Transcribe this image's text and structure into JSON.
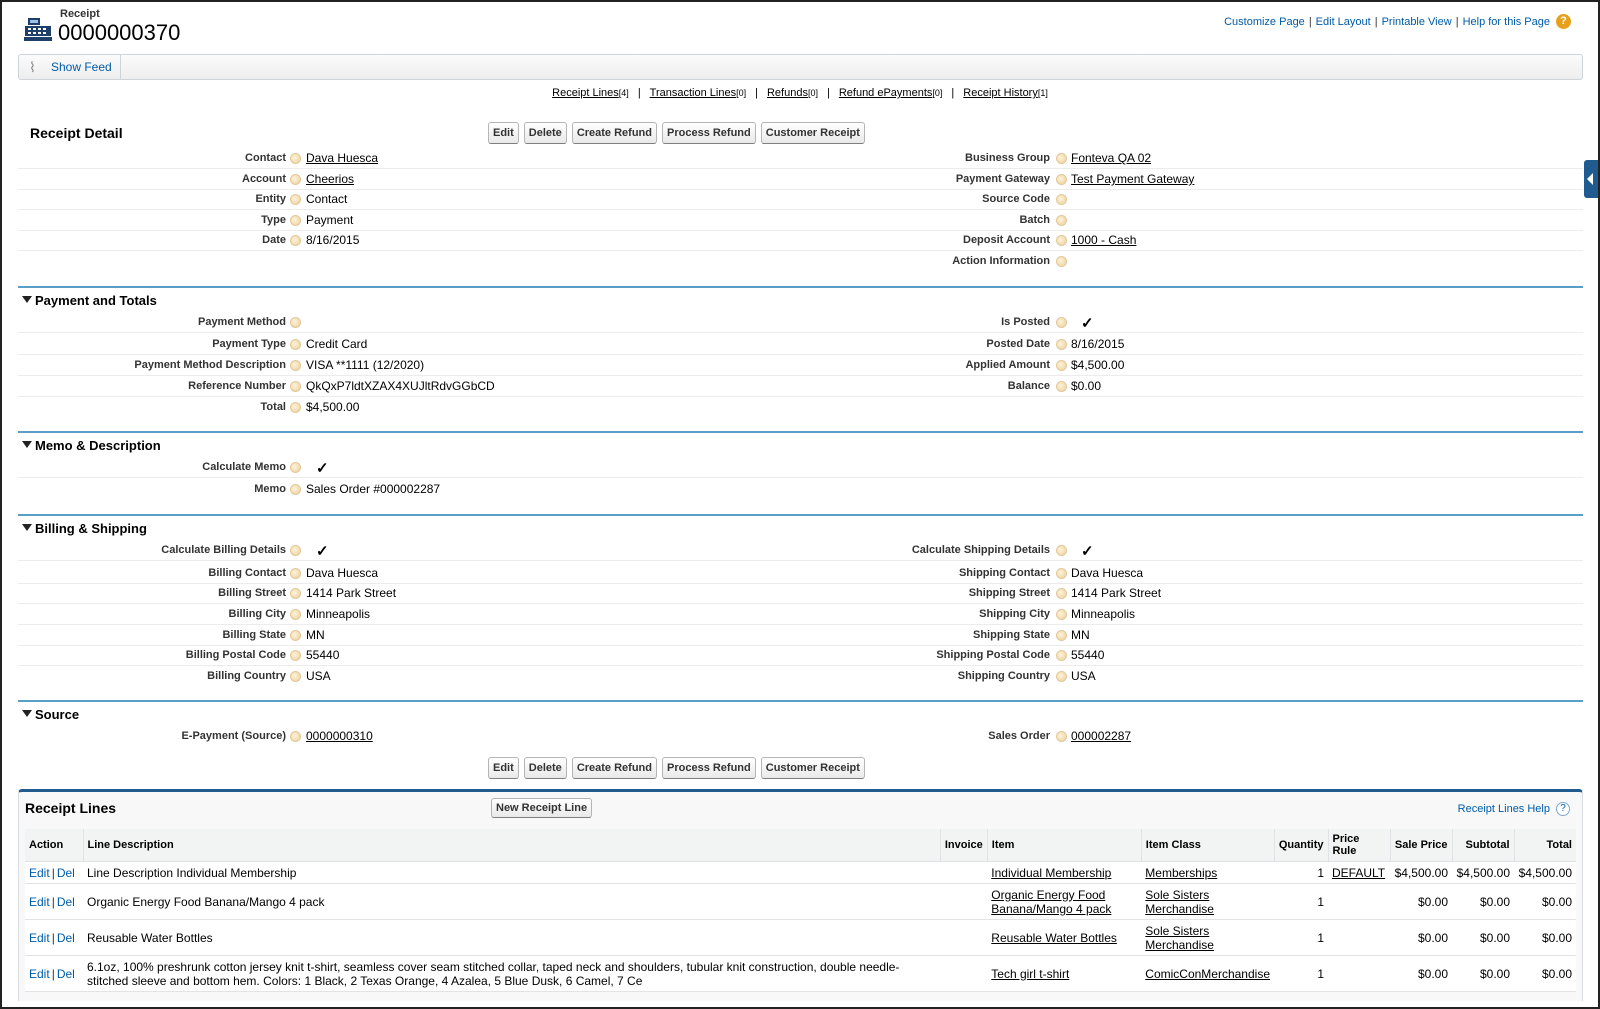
{
  "header": {
    "object_type": "Receipt",
    "record_name": "0000000370",
    "links": [
      "Customize Page",
      "Edit Layout",
      "Printable View",
      "Help for this Page"
    ],
    "help_icon": "?"
  },
  "feed": {
    "label": "Show Feed"
  },
  "related_links": [
    {
      "label": "Receipt Lines",
      "count": "[4]"
    },
    {
      "label": "Transaction Lines",
      "count": "[0]"
    },
    {
      "label": "Refunds",
      "count": "[0]"
    },
    {
      "label": "Refund ePayments",
      "count": "[0]"
    },
    {
      "label": "Receipt History",
      "count": "[1]"
    }
  ],
  "detail": {
    "title": "Receipt Detail",
    "buttons": [
      "Edit",
      "Delete",
      "Create Refund",
      "Process Refund",
      "Customer Receipt"
    ]
  },
  "receipt_fields_left": [
    {
      "label": "Contact",
      "value": "Dava Huesca",
      "link": true
    },
    {
      "label": "Account",
      "value": "Cheerios",
      "link": true
    },
    {
      "label": "Entity",
      "value": "Contact",
      "link": false
    },
    {
      "label": "Type",
      "value": "Payment",
      "link": false
    },
    {
      "label": "Date",
      "value": "8/16/2015",
      "link": false
    }
  ],
  "receipt_fields_right": [
    {
      "label": "Business Group",
      "value": "Fonteva QA 02",
      "link": true
    },
    {
      "label": "Payment Gateway",
      "value": "Test Payment Gateway",
      "link": true
    },
    {
      "label": "Source Code",
      "value": "",
      "link": false
    },
    {
      "label": "Batch",
      "value": "",
      "link": false
    },
    {
      "label": "Deposit Account",
      "value": "1000 - Cash",
      "link": true
    },
    {
      "label": "Action Information",
      "value": "",
      "link": false
    }
  ],
  "sections": {
    "payment": {
      "title": "Payment and Totals",
      "left": [
        {
          "label": "Payment Method",
          "value": ""
        },
        {
          "label": "Payment Type",
          "value": "Credit Card"
        },
        {
          "label": "Payment Method Description",
          "value": "VISA **1111 (12/2020)"
        },
        {
          "label": "Reference Number",
          "value": "QkQxP7ldtXZAX4XUJltRdvGGbCD"
        },
        {
          "label": "Total",
          "value": "$4,500.00"
        }
      ],
      "right": [
        {
          "label": "Is Posted",
          "value": "✓"
        },
        {
          "label": "Posted Date",
          "value": "8/16/2015"
        },
        {
          "label": "Applied Amount",
          "value": "$4,500.00"
        },
        {
          "label": "Balance",
          "value": "$0.00"
        }
      ]
    },
    "memo": {
      "title": "Memo & Description",
      "left": [
        {
          "label": "Calculate Memo",
          "value": "✓"
        },
        {
          "label": "Memo",
          "value": "Sales Order #000002287"
        }
      ]
    },
    "billing": {
      "title": "Billing & Shipping",
      "left": [
        {
          "label": "Calculate Billing Details",
          "value": "✓"
        },
        {
          "label": "Billing Contact",
          "value": "Dava Huesca"
        },
        {
          "label": "Billing Street",
          "value": "1414 Park Street"
        },
        {
          "label": "Billing City",
          "value": "Minneapolis"
        },
        {
          "label": "Billing State",
          "value": "MN"
        },
        {
          "label": "Billing Postal Code",
          "value": "55440"
        },
        {
          "label": "Billing Country",
          "value": "USA"
        }
      ],
      "right": [
        {
          "label": "Calculate Shipping Details",
          "value": "✓"
        },
        {
          "label": "Shipping Contact",
          "value": "Dava Huesca"
        },
        {
          "label": "Shipping Street",
          "value": "1414 Park Street"
        },
        {
          "label": "Shipping City",
          "value": "Minneapolis"
        },
        {
          "label": "Shipping State",
          "value": "MN"
        },
        {
          "label": "Shipping Postal Code",
          "value": "55440"
        },
        {
          "label": "Shipping Country",
          "value": "USA"
        }
      ]
    },
    "source": {
      "title": "Source",
      "left": [
        {
          "label": "E-Payment (Source)",
          "value": "0000000310"
        }
      ],
      "right": [
        {
          "label": "Sales Order",
          "value": "000002287"
        }
      ]
    }
  },
  "receipt_lines": {
    "title": "Receipt Lines",
    "new_button": "New Receipt Line",
    "help": "Receipt Lines Help",
    "columns": [
      "Action",
      "Line Description",
      "Invoice",
      "Item",
      "Item Class",
      "Quantity",
      "Price Rule",
      "Sale Price",
      "Subtotal",
      "Total"
    ],
    "edit_label": "Edit",
    "del_label": "Del",
    "rows": [
      {
        "description": "Line Description Individual Membership",
        "invoice": "",
        "item": "Individual Membership",
        "item_class": "Memberships",
        "quantity": "1",
        "price_rule": "DEFAULT",
        "sale_price": "$4,500.00",
        "subtotal": "$4,500.00",
        "total": "$4,500.00"
      },
      {
        "description": "Organic Energy Food Banana/Mango 4 pack",
        "invoice": "",
        "item": "Organic Energy Food Banana/Mango 4 pack",
        "item_class": "Sole Sisters Merchandise",
        "quantity": "1",
        "price_rule": "",
        "sale_price": "$0.00",
        "subtotal": "$0.00",
        "total": "$0.00"
      },
      {
        "description": "Reusable Water Bottles",
        "invoice": "",
        "item": "Reusable Water Bottles",
        "item_class": "Sole Sisters Merchandise",
        "quantity": "1",
        "price_rule": "",
        "sale_price": "$0.00",
        "subtotal": "$0.00",
        "total": "$0.00"
      },
      {
        "description": "6.1oz, 100% preshrunk cotton jersey knit t-shirt, seamless cover seam stitched collar, taped neck and shoulders, tubular knit construction, double needle-stitched sleeve and bottom hem. Colors: 1 Black, 2 Texas Orange, 4 Azalea, 5 Blue Dusk, 6 Camel, 7 Ce",
        "invoice": "",
        "item": "Tech girl t-shirt",
        "item_class": "ComicConMerchandise",
        "quantity": "1",
        "price_rule": "",
        "sale_price": "$0.00",
        "subtotal": "$0.00",
        "total": "$0.00"
      }
    ]
  }
}
